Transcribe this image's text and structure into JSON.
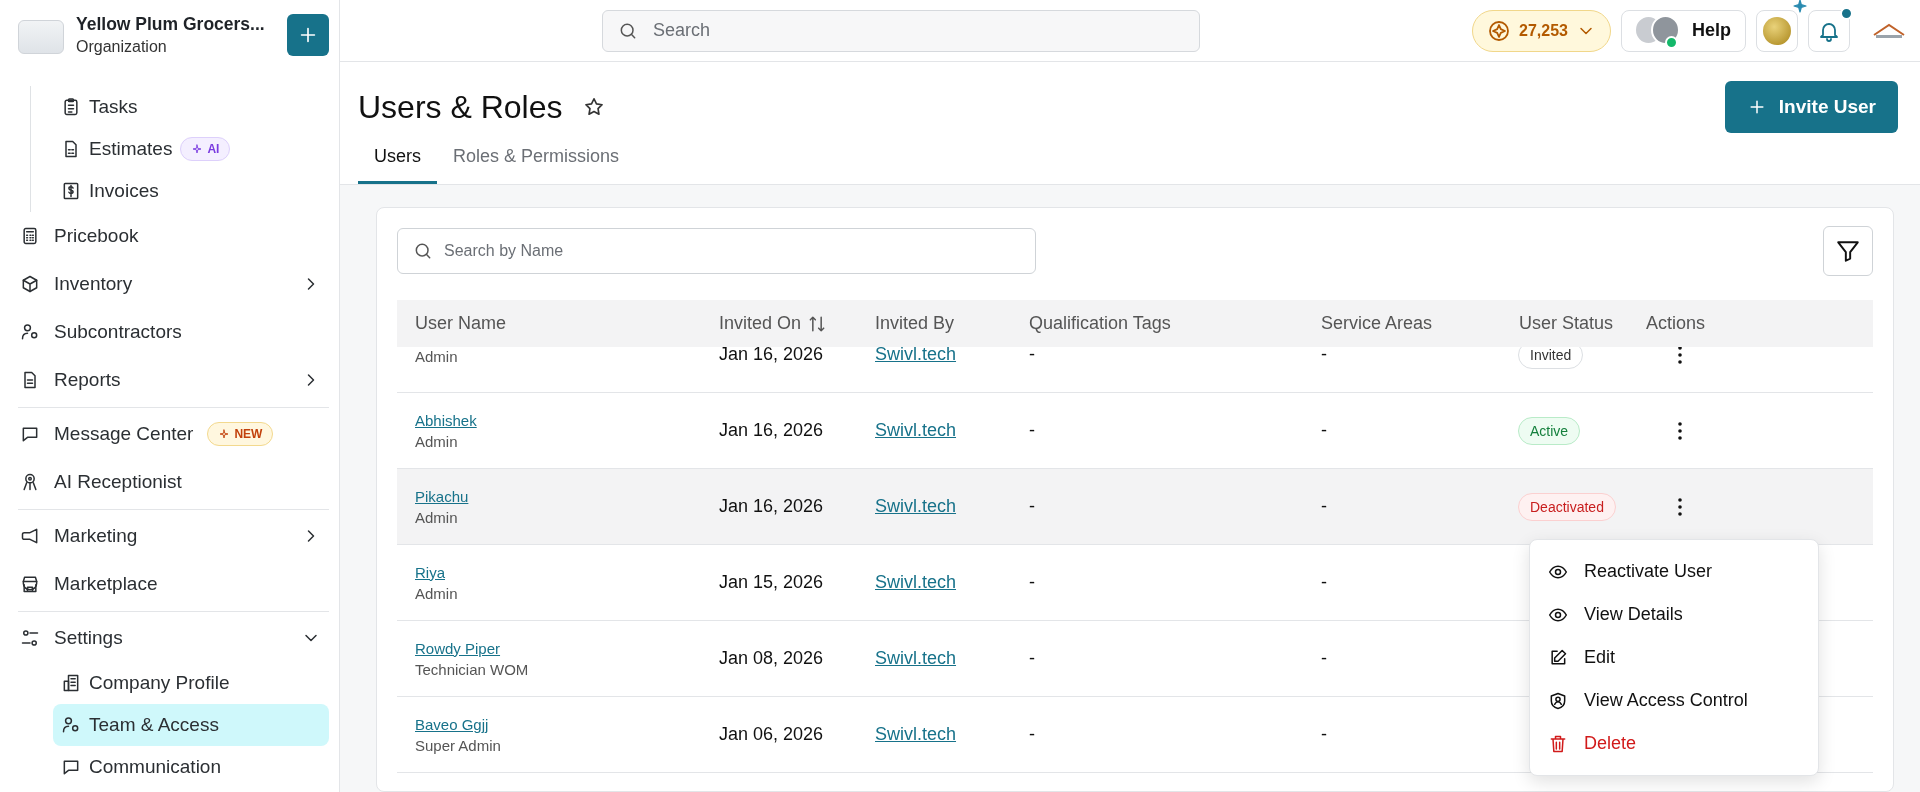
{
  "sidebar": {
    "org": {
      "name": "Yellow Plum Grocers...",
      "subtitle": "Organization"
    },
    "groups": [
      {
        "items": [
          {
            "children": [
              {
                "label": "Tasks",
                "selected": false
              },
              {
                "label": "Estimates",
                "selected": false,
                "badge": {
                  "kind": "ai",
                  "label": "AI"
                }
              },
              {
                "label": "Invoices",
                "selected": false
              }
            ]
          },
          {
            "label": "Pricebook",
            "selected": false
          },
          {
            "label": "Inventory",
            "selected": false,
            "expanded": false
          },
          {
            "label": "Subcontractors",
            "selected": false
          },
          {
            "label": "Reports",
            "selected": false,
            "expanded": false
          }
        ]
      },
      {
        "items": [
          {
            "label": "Message Center",
            "selected": false,
            "badge": {
              "kind": "new",
              "label": "NEW"
            }
          },
          {
            "label": "AI Receptionist",
            "selected": false
          }
        ]
      },
      {
        "items": [
          {
            "label": "Marketing",
            "selected": false,
            "expanded": false
          },
          {
            "label": "Marketplace",
            "selected": false
          }
        ]
      },
      {
        "items": [
          {
            "label": "Settings",
            "selected": false,
            "expanded": true,
            "children": [
              {
                "label": "Company Profile",
                "selected": false
              },
              {
                "label": "Team & Access",
                "selected": true
              },
              {
                "label": "Communication",
                "selected": false
              }
            ]
          }
        ]
      }
    ]
  },
  "topbar": {
    "search": {
      "placeholder": "Search"
    },
    "coins": "27,253",
    "help": "Help",
    "notifications": {
      "unread": true
    }
  },
  "page": {
    "title": "Users & Roles",
    "favorite": false,
    "invite_button": "Invite User",
    "tabs": [
      {
        "label": "Users",
        "selected": true
      },
      {
        "label": "Roles & Permissions",
        "selected": false
      }
    ]
  },
  "table": {
    "search": {
      "placeholder": "Search by Name"
    },
    "columns": [
      {
        "label": "User Name",
        "sortable": false
      },
      {
        "label": "Invited On",
        "sortable": true
      },
      {
        "label": "Invited By",
        "sortable": false
      },
      {
        "label": "Qualification Tags",
        "sortable": false
      },
      {
        "label": "Service Areas",
        "sortable": false
      },
      {
        "label": "User Status",
        "sortable": false
      },
      {
        "label": "Actions",
        "sortable": false
      }
    ],
    "rows": [
      {
        "role": "Admin",
        "invited_on": "Jan 16, 2026",
        "invited_by": "Swivl.tech",
        "qualification_tags": "-",
        "service_areas": "-",
        "status": {
          "label": "Invited",
          "kind": "invited"
        },
        "selected": false
      },
      {
        "name": "Abhishek",
        "role": "Admin",
        "invited_on": "Jan 16, 2026",
        "invited_by": "Swivl.tech",
        "qualification_tags": "-",
        "service_areas": "-",
        "status": {
          "label": "Active",
          "kind": "active"
        },
        "selected": false
      },
      {
        "name": "Pikachu",
        "role": "Admin",
        "invited_on": "Jan 16, 2026",
        "invited_by": "Swivl.tech",
        "qualification_tags": "-",
        "service_areas": "-",
        "status": {
          "label": "Deactivated",
          "kind": "deactivated"
        },
        "selected": true
      },
      {
        "name": "Riya",
        "role": "Admin",
        "invited_on": "Jan 15, 2026",
        "invited_by": "Swivl.tech",
        "qualification_tags": "-",
        "service_areas": "-",
        "selected": false
      },
      {
        "name": "Rowdy Piper",
        "role": "Technician WOM",
        "invited_on": "Jan 08, 2026",
        "invited_by": "Swivl.tech",
        "qualification_tags": "-",
        "service_areas": "-",
        "selected": false
      },
      {
        "name": "Baveo Ggjj",
        "role": "Super Admin",
        "invited_on": "Jan 06, 2026",
        "invited_by": "Swivl.tech",
        "qualification_tags": "-",
        "service_areas": "-",
        "selected": false
      }
    ]
  },
  "action_menu": {
    "items": [
      {
        "label": "Reactivate User",
        "kind": "normal"
      },
      {
        "label": "View Details",
        "kind": "normal"
      },
      {
        "label": "Edit",
        "kind": "normal"
      },
      {
        "label": "View Access Control",
        "kind": "normal"
      },
      {
        "label": "Delete",
        "kind": "danger"
      }
    ]
  }
}
